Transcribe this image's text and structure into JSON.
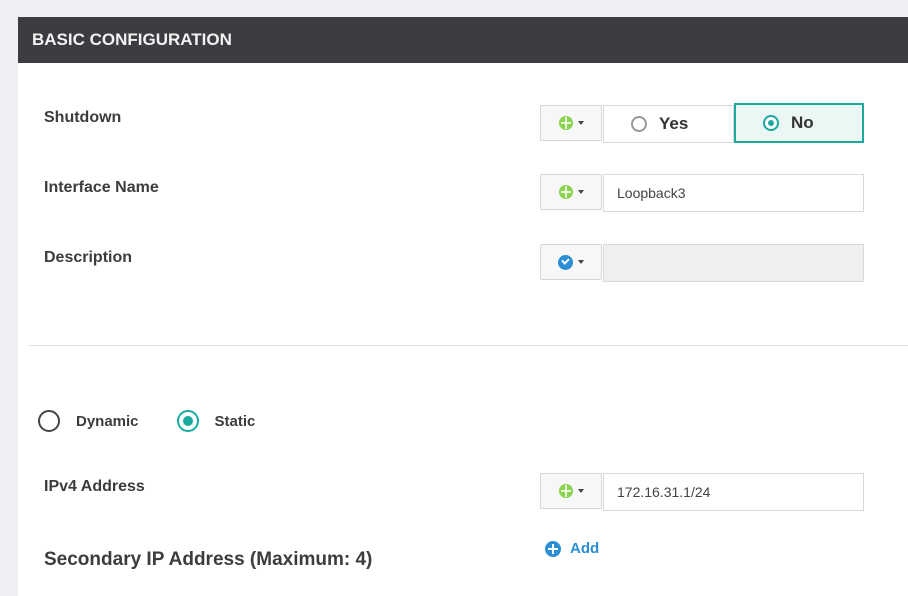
{
  "section": {
    "title": "BASIC CONFIGURATION"
  },
  "shutdown": {
    "label": "Shutdown",
    "options": [
      "Yes",
      "No"
    ],
    "selected": "No"
  },
  "interface_name": {
    "label": "Interface Name",
    "value": "Loopback3"
  },
  "description": {
    "label": "Description",
    "value": ""
  },
  "addressing": {
    "options": [
      "Dynamic",
      "Static"
    ],
    "selected": "Static"
  },
  "ipv4": {
    "label": "IPv4 Address",
    "value": "172.16.31.1/24"
  },
  "secondary": {
    "label": "Secondary IP Address (Maximum: 4)",
    "add_label": "Add"
  },
  "colors": {
    "accent": "#1aaa9e",
    "header_bg": "#3b3d40",
    "link": "#2a8fd4",
    "scope_globe": "#8cd34f"
  }
}
